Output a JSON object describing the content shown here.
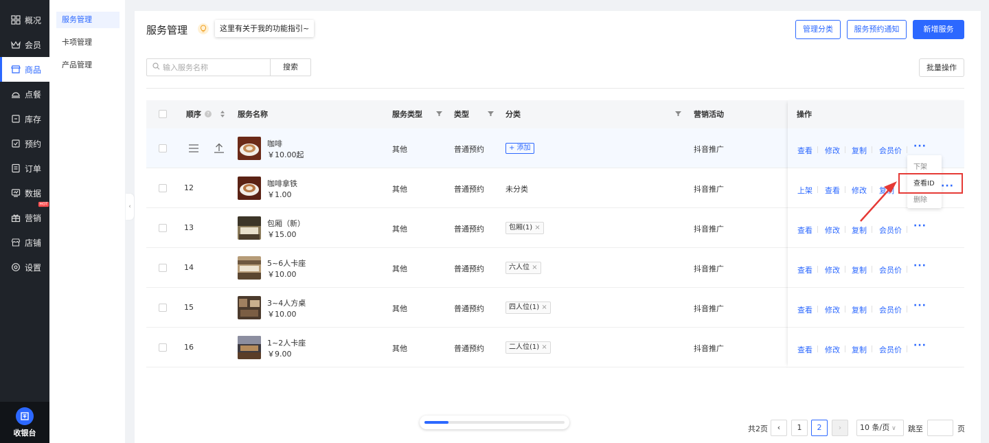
{
  "nav": {
    "items": [
      {
        "label": "概况",
        "icon": "grid-icon"
      },
      {
        "label": "会员",
        "icon": "crown-icon"
      },
      {
        "label": "商品",
        "icon": "shop-icon"
      },
      {
        "label": "点餐",
        "icon": "dish-icon"
      },
      {
        "label": "库存",
        "icon": "box-icon"
      },
      {
        "label": "预约",
        "icon": "calendar-check-icon"
      },
      {
        "label": "订单",
        "icon": "order-icon"
      },
      {
        "label": "数据",
        "icon": "chart-icon"
      },
      {
        "label": "营销",
        "icon": "gift-icon"
      },
      {
        "label": "店铺",
        "icon": "store-icon"
      },
      {
        "label": "设置",
        "icon": "gear-icon"
      }
    ],
    "active_index": 2,
    "hot_badge": "HOT",
    "cashier_label": "收银台"
  },
  "subnav": {
    "items": [
      "服务管理",
      "卡项管理",
      "产品管理"
    ]
  },
  "header": {
    "title": "服务管理",
    "tip": "这里有关于我的功能指引~",
    "btn_category": "管理分类",
    "btn_notice": "服务预约通知",
    "btn_add": "新增服务",
    "btn_batch": "批量操作"
  },
  "search": {
    "placeholder": "输入服务名称",
    "button": "搜索"
  },
  "table": {
    "headers": {
      "order": "顺序",
      "name": "服务名称",
      "service_type": "服务类型",
      "type": "类型",
      "category": "分类",
      "marketing": "营销活动",
      "ops": "操作"
    },
    "rows": [
      {
        "order": "",
        "name": "咖啡",
        "price": "￥10.00起",
        "service_type": "其他",
        "type": "普通预约",
        "category": "",
        "marketing": "抖音推广",
        "ops": [
          "查看",
          "修改",
          "复制",
          "会员价"
        ]
      },
      {
        "order": "12",
        "name": "咖啡拿铁",
        "price": "￥1.00",
        "service_type": "其他",
        "type": "普通预约",
        "category": "未分类",
        "marketing": "抖音推广",
        "ops": [
          "上架",
          "查看",
          "修改",
          "复制"
        ]
      },
      {
        "order": "13",
        "name": "包厢（新）",
        "price": "￥15.00",
        "service_type": "其他",
        "type": "普通预约",
        "category": "包厢(1)",
        "marketing": "抖音推广",
        "ops": [
          "查看",
          "修改",
          "复制",
          "会员价"
        ]
      },
      {
        "order": "14",
        "name": "5~6人卡座",
        "price": "￥10.00",
        "service_type": "其他",
        "type": "普通预约",
        "category": "六人位",
        "marketing": "抖音推广",
        "ops": [
          "查看",
          "修改",
          "复制",
          "会员价"
        ]
      },
      {
        "order": "15",
        "name": "3~4人方桌",
        "price": "￥10.00",
        "service_type": "其他",
        "type": "普通预约",
        "category": "四人位(1)",
        "marketing": "抖音推广",
        "ops": [
          "查看",
          "修改",
          "复制",
          "会员价"
        ]
      },
      {
        "order": "16",
        "name": "1~2人卡座",
        "price": "￥9.00",
        "service_type": "其他",
        "type": "普通预约",
        "category": "二人位(1)",
        "marketing": "抖音推广",
        "ops": [
          "查看",
          "修改",
          "复制",
          "会员价"
        ]
      }
    ],
    "add_tag_label": "+ 添加",
    "more_label": "···",
    "tag_close": "×"
  },
  "dropdown": {
    "items": [
      "下架",
      "查看ID",
      "删除"
    ]
  },
  "pagination": {
    "total": "共2页",
    "pages": [
      "1",
      "2"
    ],
    "current": "2",
    "prev": "‹",
    "next": "›",
    "page_size": "10 条/页",
    "jump_label": "跳至",
    "page_unit": "页"
  },
  "scroll_progress": 0.17,
  "colors": {
    "accent": "#2c68ff",
    "nav_bg": "#1f2329",
    "highlight": "#e53935"
  }
}
